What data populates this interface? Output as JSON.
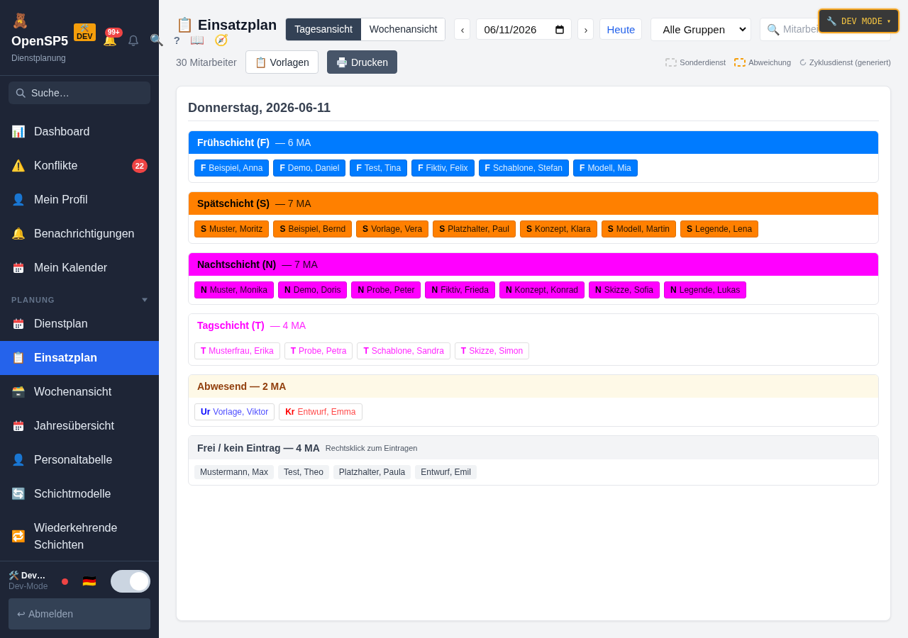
{
  "sidebar": {
    "logo": "🧸",
    "app_name": "OpenSP5",
    "subtitle": "Dienstplanung",
    "dev_badge": {
      "icon": "🛠️",
      "label": "DEV"
    },
    "notifications": {
      "icon": "🔔",
      "count": "99+"
    },
    "header_icons": [
      "🔍",
      "?",
      "📖",
      "🧭"
    ],
    "search": {
      "placeholder": "Suche…"
    },
    "nav": [
      {
        "kind": "emoji",
        "icon": "📊",
        "label": "Dashboard",
        "selected": false
      },
      {
        "kind": "emoji",
        "icon": "⚠️",
        "label": "Konflikte",
        "badge": "22",
        "selected": false
      },
      {
        "kind": "emoji",
        "icon": "👤",
        "label": "Mein Profil",
        "selected": false
      },
      {
        "kind": "emoji",
        "icon": "🔔",
        "label": "Benachrichtigungen",
        "selected": false
      },
      {
        "kind": "calendar",
        "label": "Mein Kalender",
        "selected": false
      }
    ],
    "sections": [
      {
        "label": "PLANUNG",
        "expanded": true,
        "items": [
          {
            "kind": "calendar",
            "label": "Dienstplan",
            "selected": false
          },
          {
            "kind": "emoji",
            "icon": "📋",
            "label": "Einsatzplan",
            "selected": true
          },
          {
            "kind": "emoji",
            "icon": "🗃️",
            "label": "Wochenansicht",
            "selected": false
          },
          {
            "kind": "calendar",
            "label": "Jahresübersicht",
            "selected": false
          },
          {
            "kind": "emoji",
            "icon": "👤",
            "label": "Personaltabelle",
            "selected": false
          },
          {
            "kind": "emoji",
            "icon": "🔄",
            "label": "Schichtmodelle",
            "selected": false
          },
          {
            "kind": "emoji",
            "icon": "🔁",
            "label": "Wiederkehrende Schichten",
            "selected": false
          }
        ]
      }
    ],
    "footer": {
      "icon": "🛠️",
      "user": "Dev…",
      "role": "Dev-Mode",
      "flag": "🇩🇪",
      "toggle": {
        "on": true
      },
      "logout": {
        "icon": "↩",
        "label": "Abmelden"
      }
    }
  },
  "toolbar": {
    "title_icon": "📋",
    "title": "Einsatzplan",
    "views": [
      {
        "label": "Tagesansicht",
        "selected": true
      },
      {
        "label": "Wochenansicht",
        "selected": false
      }
    ],
    "prev": "‹",
    "date": "06/11/2026",
    "next": "›",
    "today": "Heute",
    "group_select": "Alle Gruppen",
    "search": {
      "icon": "🔍",
      "placeholder": "Mitarbei"
    }
  },
  "actions": {
    "employee_count": "30 Mitarbeiter",
    "buttons": [
      {
        "kind": "light",
        "icon": "📋",
        "label": "Vorlagen"
      },
      {
        "kind": "dark",
        "label": "Drucken"
      }
    ]
  },
  "legend": [
    {
      "kind": "special",
      "label": "Sonderdienst"
    },
    {
      "kind": "deviation",
      "label": "Abweichung"
    },
    {
      "kind": "cycle",
      "label": "Zyklusdienst (generiert)"
    }
  ],
  "dev_mode": {
    "icon": "🔧",
    "label": "DEV MODE",
    "caret": "▾"
  },
  "day": {
    "heading": "Donnerstag, 2026-06-11",
    "groups": [
      {
        "kind": "filled",
        "title": "Frühschicht (F)",
        "count": "— 6 MA",
        "color": "#007bff",
        "chips": [
          {
            "code": "F",
            "name": "Beispiel, Anna"
          },
          {
            "code": "F",
            "name": "Demo, Daniel"
          },
          {
            "code": "F",
            "name": "Test, Tina"
          },
          {
            "code": "F",
            "name": "Fiktiv, Felix"
          },
          {
            "code": "F",
            "name": "Schablone, Stefan"
          },
          {
            "code": "F",
            "name": "Modell, Mia"
          }
        ]
      },
      {
        "kind": "filled",
        "title": "Spätschicht (S)",
        "count": "— 7 MA",
        "color": "#ff8000",
        "chips": [
          {
            "code": "S",
            "name": "Muster, Moritz"
          },
          {
            "code": "S",
            "name": "Beispiel, Bernd"
          },
          {
            "code": "S",
            "name": "Vorlage, Vera"
          },
          {
            "code": "S",
            "name": "Platzhalter, Paul"
          },
          {
            "code": "S",
            "name": "Konzept, Klara"
          },
          {
            "code": "S",
            "name": "Modell, Martin"
          },
          {
            "code": "S",
            "name": "Legende, Lena"
          }
        ]
      },
      {
        "kind": "filled",
        "title": "Nachtschicht (N)",
        "count": "— 7 MA",
        "color": "#ff00ff",
        "chips": [
          {
            "code": "N",
            "name": "Muster, Monika"
          },
          {
            "code": "N",
            "name": "Demo, Doris"
          },
          {
            "code": "N",
            "name": "Probe, Peter"
          },
          {
            "code": "N",
            "name": "Fiktiv, Frieda"
          },
          {
            "code": "N",
            "name": "Konzept, Konrad"
          },
          {
            "code": "N",
            "name": "Skizze, Sofia"
          },
          {
            "code": "N",
            "name": "Legende, Lukas"
          }
        ]
      },
      {
        "kind": "outline",
        "title": "Tagschicht (T)",
        "count": "— 4 MA",
        "color": "#ff00ff",
        "chips": [
          {
            "code": "T",
            "name": "Musterfrau, Erika"
          },
          {
            "code": "T",
            "name": "Probe, Petra"
          },
          {
            "code": "T",
            "name": "Schablone, Sandra"
          },
          {
            "code": "T",
            "name": "Skizze, Simon"
          }
        ]
      },
      {
        "kind": "absence",
        "title": "Abwesend",
        "count": "— 2 MA",
        "chips": [
          {
            "code": "Ur",
            "name": "Vorlage, Viktor",
            "color": "#0000ff"
          },
          {
            "code": "Kr",
            "name": "Entwurf, Emma",
            "color": "#ff0000"
          }
        ]
      },
      {
        "kind": "free",
        "title": "Frei / kein Eintrag",
        "count": "— 4 MA",
        "hint": "Rechtsklick zum Eintragen",
        "chips": [
          {
            "name": "Mustermann, Max"
          },
          {
            "name": "Test, Theo"
          },
          {
            "name": "Platzhalter, Paula"
          },
          {
            "name": "Entwurf, Emil"
          }
        ]
      }
    ]
  }
}
